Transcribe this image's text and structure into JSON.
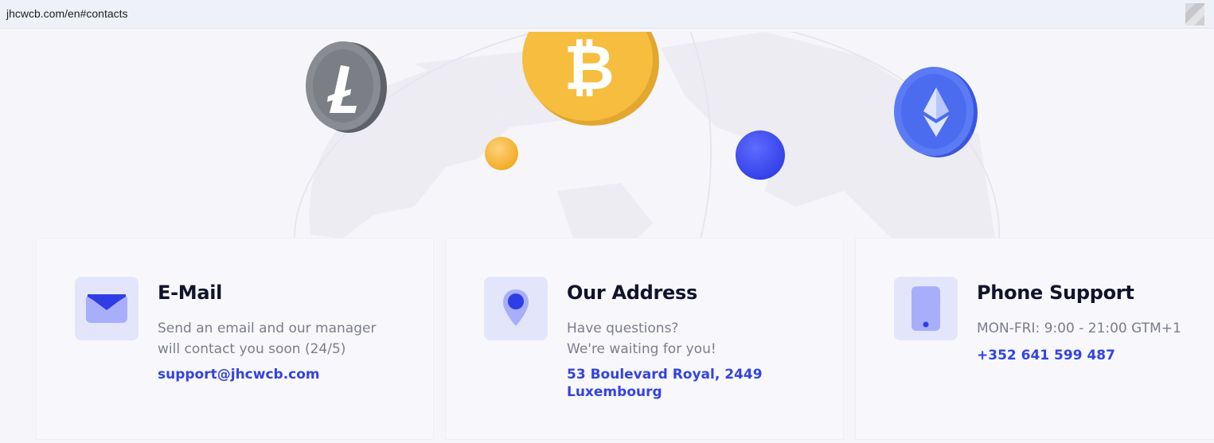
{
  "browser": {
    "url": "jhcwcb.com/en#contacts"
  },
  "colors": {
    "accent": "#3343e0",
    "icon_bg": "#e3e5fb",
    "icon_fill": "#a9aefb",
    "page_bg": "#f6f6fa"
  },
  "hero": {
    "coins": [
      "litecoin-icon",
      "bitcoin-icon",
      "ethereum-icon"
    ]
  },
  "contacts": {
    "email": {
      "icon": "envelope-icon",
      "title": "E-Mail",
      "desc_line1": "Send an email and our manager",
      "desc_line2": "will contact you soon (24/5)",
      "link": "support@jhcwcb.com"
    },
    "address": {
      "icon": "map-pin-icon",
      "title": "Our Address",
      "desc_line1": "Have questions?",
      "desc_line2": "We're waiting for you!",
      "link_line1": "53 Boulevard Royal, 2449",
      "link_line2": "Luxembourg"
    },
    "phone": {
      "icon": "smartphone-icon",
      "title": "Phone Support",
      "desc_line1": "MON-FRI: 9:00 - 21:00 GTM+1",
      "link": "+352 641 599 487"
    }
  }
}
